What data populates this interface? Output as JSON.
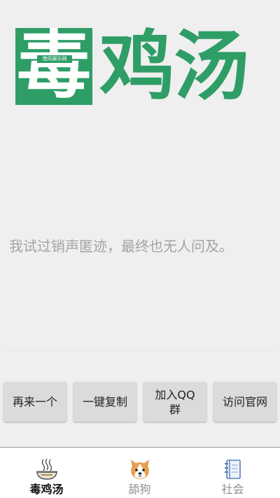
{
  "logo": {
    "box_char": "毒",
    "box_subtext": "借风娱乐网",
    "rest_text": "鸡汤"
  },
  "quote": {
    "text": "我试过销声匿迹，最终也无人问及。"
  },
  "actions": [
    {
      "label": "再来一个"
    },
    {
      "label": "一键复制"
    },
    {
      "label": "加入QQ群"
    },
    {
      "label": "访问官网"
    }
  ],
  "tabs": [
    {
      "label": "毒鸡汤",
      "icon": "soup-bowl-icon",
      "active": true
    },
    {
      "label": "舔狗",
      "icon": "dog-face-icon",
      "active": false
    },
    {
      "label": "社会",
      "icon": "notebook-icon",
      "active": false
    }
  ],
  "colors": {
    "brand_green": "#2e9e66",
    "quote_text": "#a3a3a3",
    "button_bg": "#d9dbdd"
  }
}
